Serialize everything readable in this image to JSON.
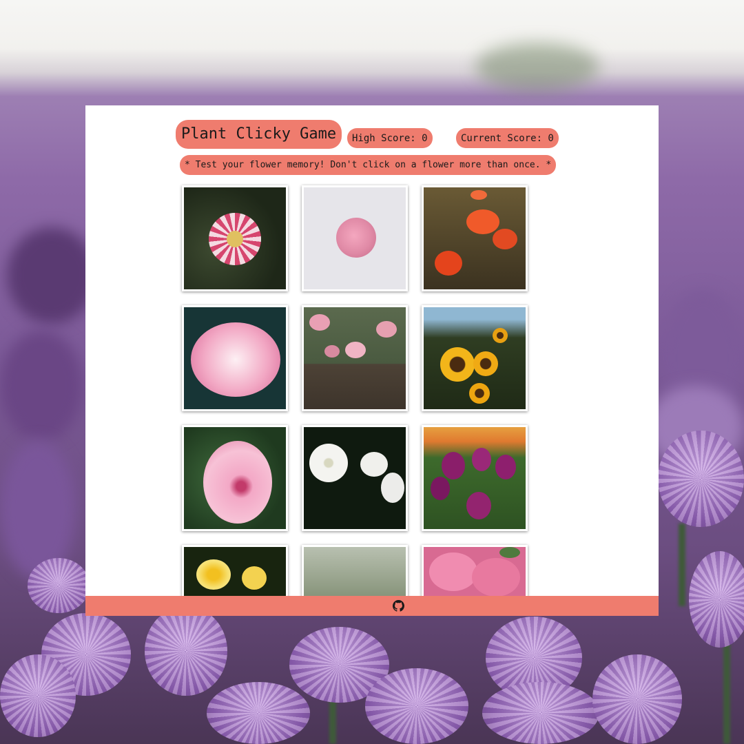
{
  "header": {
    "title": "Plant Clicky Game",
    "high_score": "High Score: 0",
    "current_score": "Current Score: 0",
    "instructions": "* Test your flower memory! Don't click on a flower more than once. *"
  },
  "cards": [
    {
      "icon": "dahlia-flower-image"
    },
    {
      "icon": "pink-rose-image"
    },
    {
      "icon": "red-poppies-image"
    },
    {
      "icon": "pink-peony-image"
    },
    {
      "icon": "pink-flower-bush-image"
    },
    {
      "icon": "sunflowers-image"
    },
    {
      "icon": "pink-hibiscus-image"
    },
    {
      "icon": "white-jasmine-image"
    },
    {
      "icon": "purple-tulips-image"
    },
    {
      "icon": "yellow-frangipani-image"
    },
    {
      "icon": "wild-grass-image"
    },
    {
      "icon": "pink-hydrangea-image"
    }
  ],
  "footer": {
    "icon": "github-icon"
  },
  "colors": {
    "accent": "#ef7c6e",
    "panel": "#ffffff",
    "background": "#8a6aa8"
  }
}
